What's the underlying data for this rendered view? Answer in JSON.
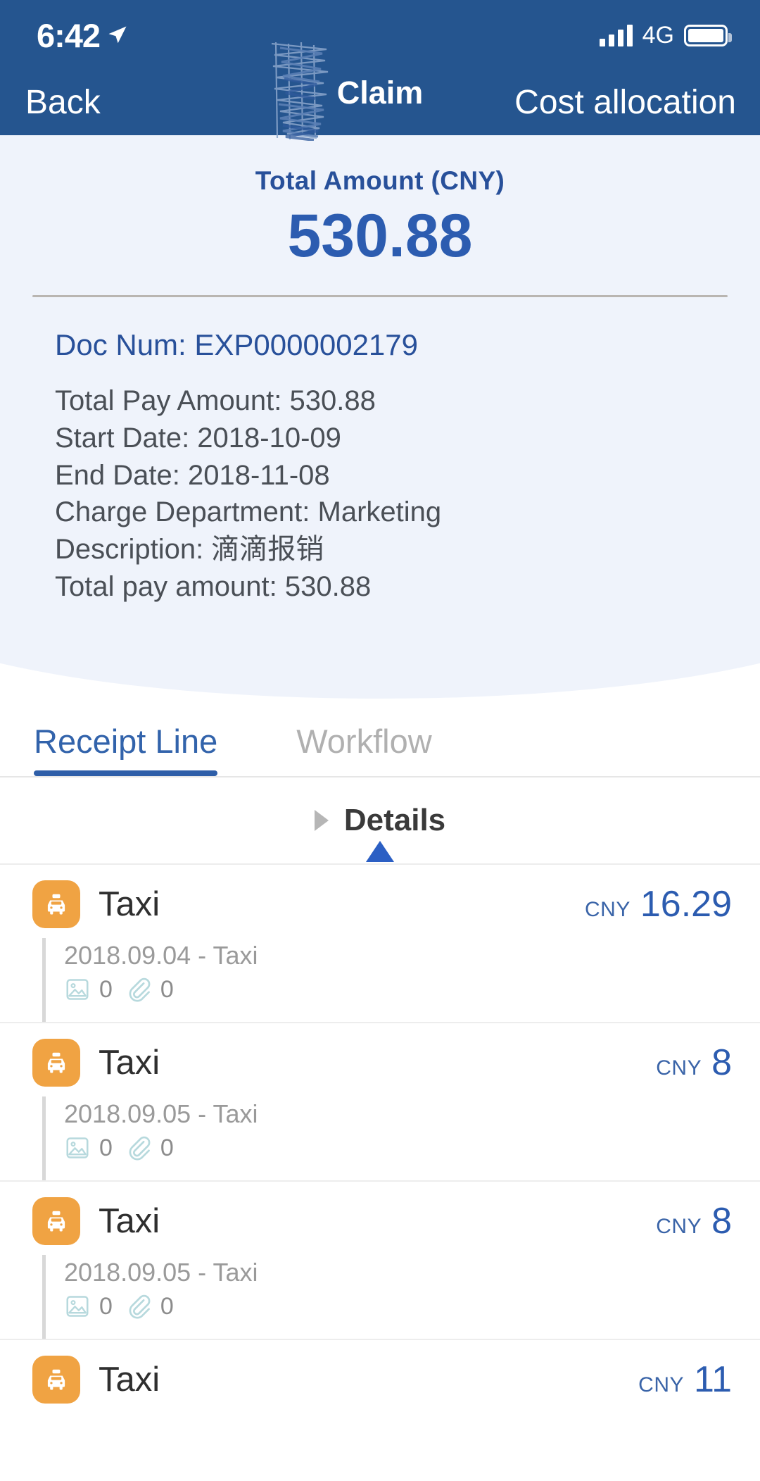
{
  "status_bar": {
    "time": "6:42",
    "location_icon": "location-arrow-icon",
    "network": "4G",
    "signal_icon": "signal-bars-icon",
    "battery_icon": "battery-full-icon"
  },
  "nav": {
    "back_label": "Back",
    "title": "Claim",
    "right_action_label": "Cost allocation",
    "redaction": "scribble-redaction-mark"
  },
  "summary": {
    "total_label": "Total Amount (CNY)",
    "total_value": "530.88",
    "doc_num": "Doc Num: EXP0000002179",
    "details": [
      "Total Pay Amount: 530.88",
      "Start Date: 2018-10-09",
      "End Date: 2018-11-08",
      "Charge Department: Marketing",
      "Description: 滴滴报销",
      "Total pay amount: 530.88"
    ],
    "collapse_icon": "triangle-up-icon"
  },
  "tabs": [
    {
      "label": "Receipt Line",
      "active": true
    },
    {
      "label": "Workflow",
      "active": false
    }
  ],
  "details_header": {
    "label": "Details",
    "icon": "triangle-right-icon"
  },
  "receipt_lines": [
    {
      "icon": "taxi-icon",
      "category": "Taxi",
      "currency": "CNY",
      "amount": "16.29",
      "sub_label": "2018.09.04 - Taxi",
      "image_count": "0",
      "attachment_count": "0"
    },
    {
      "icon": "taxi-icon",
      "category": "Taxi",
      "currency": "CNY",
      "amount": "8",
      "sub_label": "2018.09.05 - Taxi",
      "image_count": "0",
      "attachment_count": "0"
    },
    {
      "icon": "taxi-icon",
      "category": "Taxi",
      "currency": "CNY",
      "amount": "8",
      "sub_label": "2018.09.05 - Taxi",
      "image_count": "0",
      "attachment_count": "0"
    },
    {
      "icon": "taxi-icon",
      "category": "Taxi",
      "currency": "CNY",
      "amount": "11",
      "sub_label": "",
      "image_count": "",
      "attachment_count": ""
    }
  ],
  "colors": {
    "header_blue": "#25558f",
    "accent_blue": "#2c5cb0",
    "panel_bg": "#eff3fb",
    "taxi_orange": "#f0a343",
    "muted_text": "#9a9a9a",
    "icon_teal": "#b7d9dd"
  }
}
